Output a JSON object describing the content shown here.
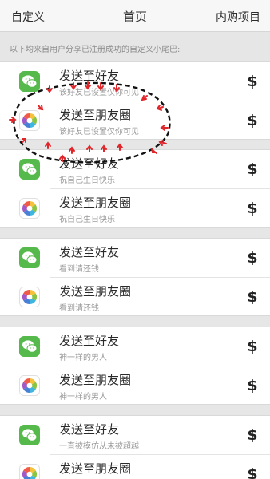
{
  "nav": {
    "left_label": "自定义",
    "title": "首页",
    "right_label": "内购项目"
  },
  "notice": "以下均来自用户分享已注册成功的自定义小尾巴:",
  "groups": [
    {
      "rows": [
        {
          "icon": "wechat-icon",
          "title": "发送至好友",
          "subtitle": "该好友已设置仅你可见"
        },
        {
          "icon": "moments-icon",
          "title": "发送至朋友圈",
          "subtitle": "该好友已设置仅你可见"
        }
      ]
    },
    {
      "rows": [
        {
          "icon": "wechat-icon",
          "title": "发送至好友",
          "subtitle": "祝自己生日快乐"
        },
        {
          "icon": "moments-icon",
          "title": "发送至朋友圈",
          "subtitle": "祝自己生日快乐"
        }
      ]
    },
    {
      "rows": [
        {
          "icon": "wechat-icon",
          "title": "发送至好友",
          "subtitle": "看到请还钱"
        },
        {
          "icon": "moments-icon",
          "title": "发送至朋友圈",
          "subtitle": "看到请还钱"
        }
      ]
    },
    {
      "rows": [
        {
          "icon": "wechat-icon",
          "title": "发送至好友",
          "subtitle": "神一样的男人"
        },
        {
          "icon": "moments-icon",
          "title": "发送至朋友圈",
          "subtitle": "神一样的男人"
        }
      ]
    },
    {
      "rows": [
        {
          "icon": "wechat-icon",
          "title": "发送至好友",
          "subtitle": "一直被模仿从未被超越"
        },
        {
          "icon": "moments-icon",
          "title": "发送至朋友圈",
          "subtitle": ""
        }
      ]
    }
  ],
  "price_symbol": "$",
  "colors": {
    "wechat_green": "#56b94b",
    "annotation_red": "#e0262b"
  }
}
